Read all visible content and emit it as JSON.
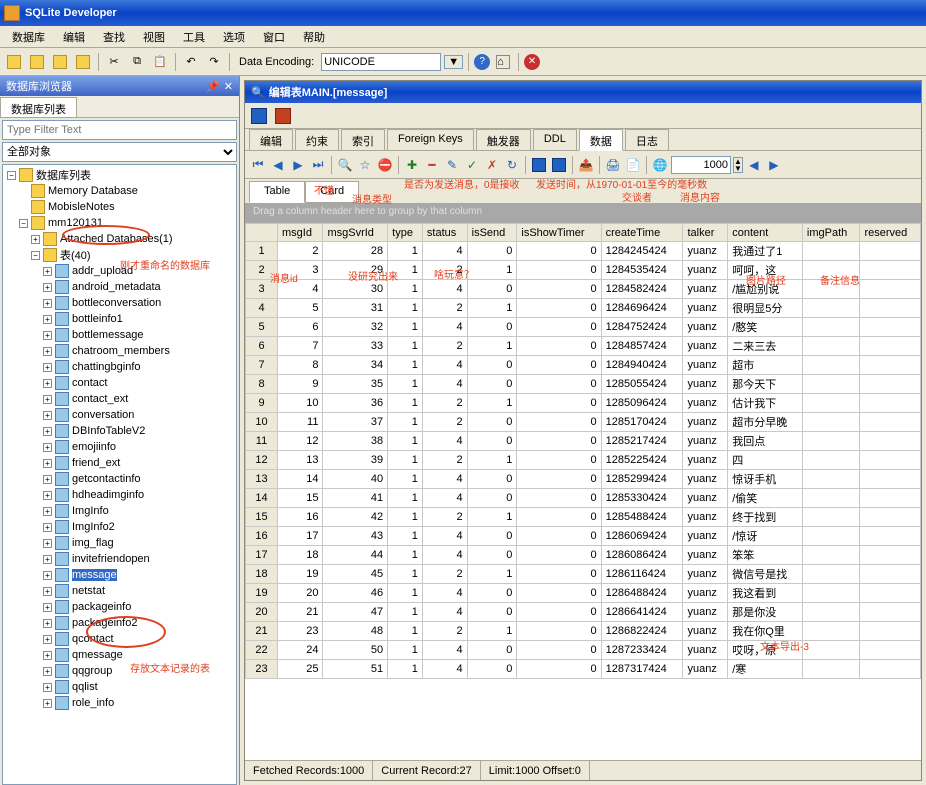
{
  "window": {
    "title": "SQLite Developer"
  },
  "menus": [
    "数据库",
    "编辑",
    "查找",
    "视图",
    "工具",
    "选项",
    "窗口",
    "帮助"
  ],
  "toolbar": {
    "encoding_label": "Data Encoding:",
    "encoding_value": "UNICODE"
  },
  "db_browser": {
    "title": "数据库浏览器",
    "tab": "数据库列表",
    "filter_placeholder": "Type Filter Text",
    "scope": "全部对象",
    "root": "数据库列表",
    "memory_db": "Memory Database",
    "mobisle": "MobisleNotes",
    "mm_db": "mm120131",
    "attached": "Attached Databases(1)",
    "tables_node": "表(40)",
    "tables": [
      "addr_upload",
      "android_metadata",
      "bottleconversation",
      "bottleinfo1",
      "bottlemessage",
      "chatroom_members",
      "chattingbginfo",
      "contact",
      "contact_ext",
      "conversation",
      "DBInfoTableV2",
      "emojiinfo",
      "friend_ext",
      "getcontactinfo",
      "hdheadimginfo",
      "ImgInfo",
      "ImgInfo2",
      "img_flag",
      "invitefriendopen",
      "message",
      "netstat",
      "packageinfo",
      "packageinfo2",
      "qcontact",
      "qmessage",
      "qqgroup",
      "qqlist",
      "role_info"
    ],
    "selected": "message"
  },
  "table_editor": {
    "title": "编辑表MAIN.[message]",
    "tabs": [
      "编辑",
      "约束",
      "索引",
      "Foreign Keys",
      "触发器",
      "DDL",
      "数据",
      "日志"
    ],
    "active_tab": "数据",
    "view_tabs": [
      "Table",
      "Card"
    ],
    "limit": "1000",
    "group_hint": "Drag a column header here to group by that column",
    "columns": [
      "msgId",
      "msgSvrId",
      "type",
      "status",
      "isSend",
      "isShowTimer",
      "createTime",
      "talker",
      "content",
      "imgPath",
      "reserved"
    ],
    "rows": [
      [
        1,
        2,
        28,
        1,
        4,
        0,
        0,
        "1284245424",
        "yuanz",
        "我通过了1",
        "",
        ""
      ],
      [
        2,
        3,
        29,
        1,
        2,
        1,
        0,
        "1284535424",
        "yuanz",
        "呵呵，这",
        "",
        ""
      ],
      [
        3,
        4,
        30,
        1,
        4,
        0,
        0,
        "1284582424",
        "yuanz",
        "/尴尬别说",
        "",
        ""
      ],
      [
        4,
        5,
        31,
        1,
        2,
        1,
        0,
        "1284696424",
        "yuanz",
        "很明显5分",
        "",
        ""
      ],
      [
        5,
        6,
        32,
        1,
        4,
        0,
        0,
        "1284752424",
        "yuanz",
        "/憨笑",
        "",
        ""
      ],
      [
        6,
        7,
        33,
        1,
        2,
        1,
        0,
        "1284857424",
        "yuanz",
        "二来三去",
        "",
        ""
      ],
      [
        7,
        8,
        34,
        1,
        4,
        0,
        0,
        "1284940424",
        "yuanz",
        "超市",
        "",
        ""
      ],
      [
        8,
        9,
        35,
        1,
        4,
        0,
        0,
        "1285055424",
        "yuanz",
        "那今天下",
        "",
        ""
      ],
      [
        9,
        10,
        36,
        1,
        2,
        1,
        0,
        "1285096424",
        "yuanz",
        "估计我下",
        "",
        ""
      ],
      [
        10,
        11,
        37,
        1,
        2,
        0,
        0,
        "1285170424",
        "yuanz",
        "超市分早晚",
        "",
        ""
      ],
      [
        11,
        12,
        38,
        1,
        4,
        0,
        0,
        "1285217424",
        "yuanz",
        "我回点",
        "",
        ""
      ],
      [
        12,
        13,
        39,
        1,
        2,
        1,
        0,
        "1285225424",
        "yuanz",
        "四",
        "",
        ""
      ],
      [
        13,
        14,
        40,
        1,
        4,
        0,
        0,
        "1285299424",
        "yuanz",
        "惊讶手机",
        "",
        ""
      ],
      [
        14,
        15,
        41,
        1,
        4,
        0,
        0,
        "1285330424",
        "yuanz",
        "/偷笑",
        "",
        ""
      ],
      [
        15,
        16,
        42,
        1,
        2,
        1,
        0,
        "1285488424",
        "yuanz",
        "终于找到",
        "",
        ""
      ],
      [
        16,
        17,
        43,
        1,
        4,
        0,
        0,
        "1286069424",
        "yuanz",
        "/惊讶",
        "",
        ""
      ],
      [
        17,
        18,
        44,
        1,
        4,
        0,
        0,
        "1286086424",
        "yuanz",
        "笨笨",
        "",
        ""
      ],
      [
        18,
        19,
        45,
        1,
        2,
        1,
        0,
        "1286116424",
        "yuanz",
        "微信号是找",
        "",
        ""
      ],
      [
        19,
        20,
        46,
        1,
        4,
        0,
        0,
        "1286488424",
        "yuanz",
        "我这看到",
        "",
        ""
      ],
      [
        20,
        21,
        47,
        1,
        4,
        0,
        0,
        "1286641424",
        "yuanz",
        "那是你没",
        "",
        ""
      ],
      [
        21,
        23,
        48,
        1,
        2,
        1,
        0,
        "1286822424",
        "yuanz",
        "我在你Q里",
        "",
        ""
      ],
      [
        22,
        24,
        50,
        1,
        4,
        0,
        0,
        "1287233424",
        "yuanz",
        "哎呀，原",
        "",
        ""
      ],
      [
        23,
        25,
        51,
        1,
        4,
        0,
        0,
        "1287317424",
        "yuanz",
        "/寒",
        "",
        ""
      ]
    ],
    "status": {
      "fetched": "Fetched Records:1000",
      "current": "Current Record:27",
      "limit": "Limit:1000 Offset:0"
    }
  },
  "annotations": {
    "renamed": "刚才重命名的数据库",
    "msg_table": "存放文本记录的表",
    "noknow": "不懂",
    "msgtype": "消息类型",
    "issend": "是否为发送消息，0是接收",
    "sendtime": "发送时间，从1970-01-01至今的毫秒数",
    "talker": "交谈者",
    "content": "消息内容",
    "msgid": "消息id",
    "research": "没研究出来",
    "what": "啥玩意？",
    "imgpath": "图片路径",
    "reserved": "备注信息",
    "export": "文本导出-3"
  }
}
